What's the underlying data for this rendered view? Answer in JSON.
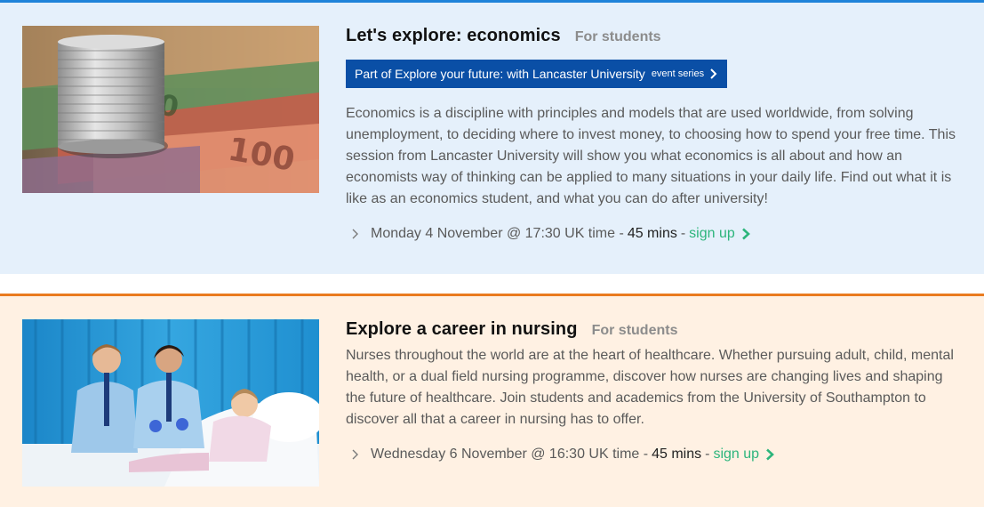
{
  "events": [
    {
      "title": "Let's explore: economics",
      "audience": "For students",
      "series_label": "Part of Explore your future: with Lancaster University",
      "series_tag": "event series",
      "description": "Economics is a discipline with principles and models that are used worldwide, from solving unemployment, to deciding where to invest money, to choosing how to spend your free time. This session from Lancaster University will show you what economics is all about and how an economists way of thinking can be applied to many situations in your daily life. Find out what it is like as an economics student, and what you can do after university!",
      "datetime": "Monday 4 November @ 17:30 UK time -",
      "duration": "45 mins",
      "dash": "-",
      "signup": "sign up",
      "accent": "#1f83d9",
      "image": "coins-banknotes-photo"
    },
    {
      "title": "Explore a career in nursing",
      "audience": "For students",
      "description": "Nurses throughout the world are at the heart of healthcare. Whether pursuing adult, child, mental health, or a dual field nursing programme, discover how nurses are changing lives and shaping the future of healthcare. Join students and academics from the University of Southampton to discover all that a career in nursing has to offer.",
      "datetime": "Wednesday 6 November @ 16:30 UK time -",
      "duration": "45 mins",
      "dash": "-",
      "signup": "sign up",
      "accent": "#ea7b1f",
      "image": "nurses-with-child-photo"
    }
  ],
  "colors": {
    "econ_bg": "#e5f0fb",
    "nurse_bg": "#fff1e3",
    "series_pill": "#0a4fa6",
    "signup_green": "#2db57c"
  }
}
